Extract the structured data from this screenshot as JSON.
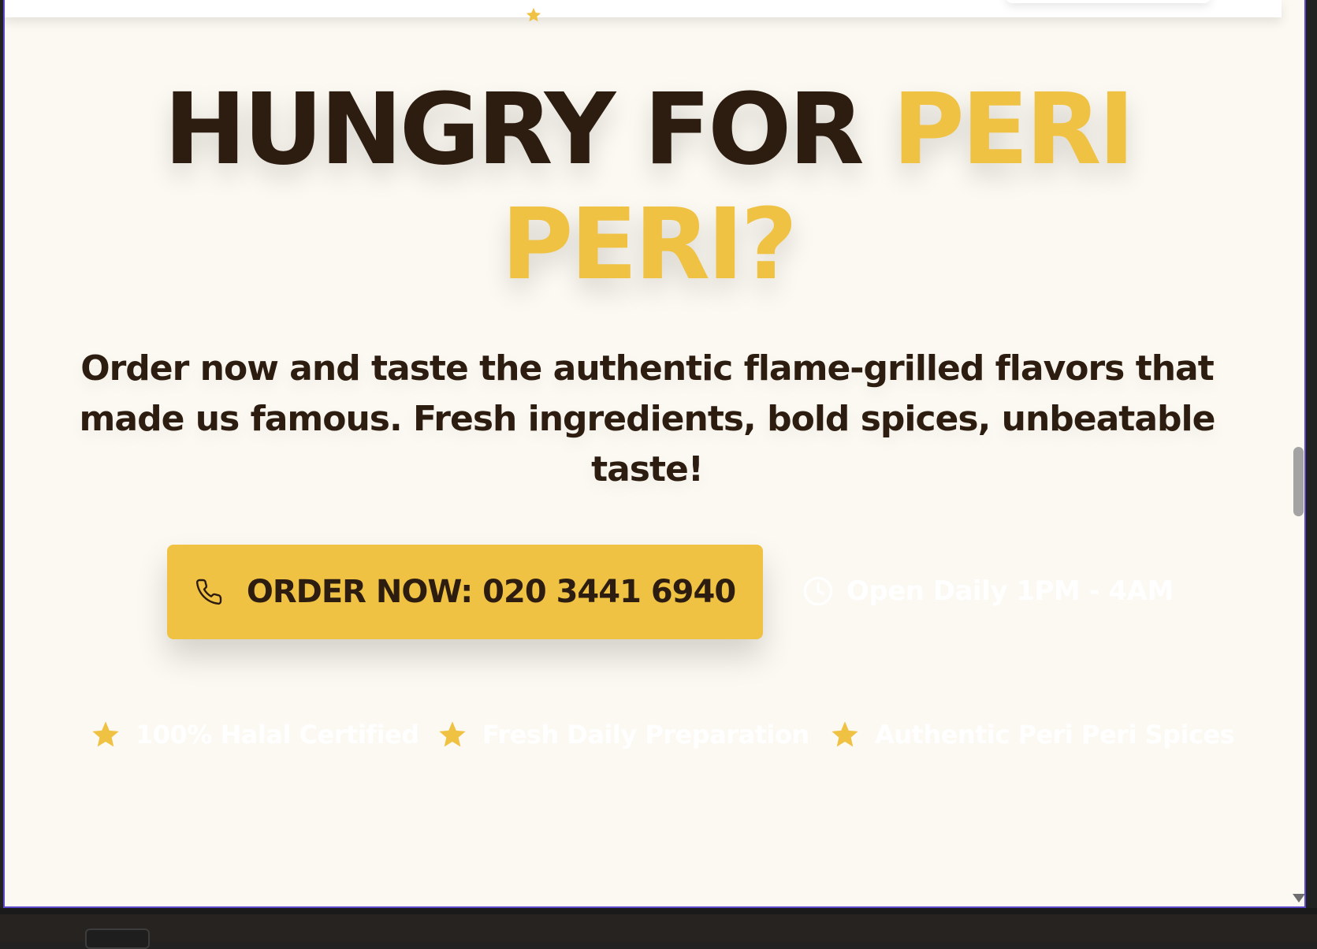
{
  "hero": {
    "headline_dark": "HUNGRY FOR ",
    "headline_accent_1": "PERI",
    "headline_accent_2": "PERI?",
    "subtext": "Order now and taste the authentic flame-grilled flavors that made us famous. Fresh ingredients, bold spices, unbeatable taste!",
    "order_button_label": "ORDER NOW: 020 3441 6940",
    "hours_label": "Open Daily 1PM - 4AM"
  },
  "features": [
    {
      "label": "100% Halal Certified",
      "icon": "star-icon"
    },
    {
      "label": "Fresh Daily Preparation",
      "icon": "star-icon"
    },
    {
      "label": "Authentic Peri Peri Spices",
      "icon": "star-icon"
    }
  ],
  "icons": {
    "order_button": "phone-icon",
    "hours": "clock-icon"
  },
  "colors": {
    "background": "#fcf9f2",
    "text_dark": "#2d1d10",
    "accent": "#f0c243",
    "muted_text": "#ffffff"
  }
}
